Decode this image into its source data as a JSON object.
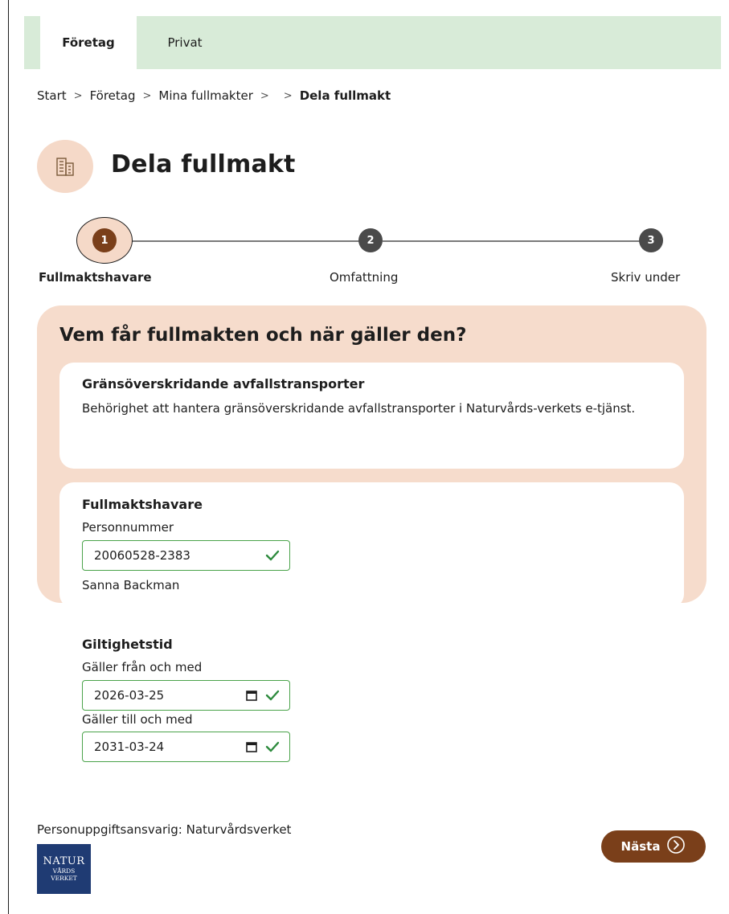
{
  "tabs": [
    {
      "label": "Företag",
      "active": true
    },
    {
      "label": "Privat",
      "active": false
    }
  ],
  "breadcrumb": [
    "Start",
    "Företag",
    "Mina fullmakter",
    "",
    "Dela fullmakt"
  ],
  "page": {
    "title": "Dela fullmakt",
    "icon": "building-icon"
  },
  "stepper": {
    "steps": [
      {
        "number": "1",
        "label": "Fullmaktshavare",
        "state": "active"
      },
      {
        "number": "2",
        "label": "Omfattning",
        "state": "inactive"
      },
      {
        "number": "3",
        "label": "Skriv under",
        "state": "inactive"
      }
    ]
  },
  "form": {
    "heading": "Vem får fullmakten och när gäller den?",
    "permission": {
      "title": "Gränsöverskridande avfallstransporter",
      "description": "Behörighet att hantera gränsöverskridande avfallstransporter i Naturvårds-verkets e-tjänst."
    },
    "holder": {
      "title": "Fullmaktshavare",
      "id_label": "Personnummer",
      "id_value": "20060528-2383",
      "name": "Sanna Backman"
    },
    "validity": {
      "title": "Giltighetstid",
      "from_label": "Gäller från och med",
      "from_value": "2026-03-25",
      "to_label": "Gäller till och med",
      "to_value": "2031-03-24"
    }
  },
  "footer": {
    "controller_text": "Personuppgiftsansvarig: Naturvårdsverket",
    "logo_line1": "NATUR",
    "logo_line2": "VÅRDS",
    "logo_line3": "VERKET",
    "next_label": "Nästa"
  },
  "colors": {
    "tabbar": "#d8ebd8",
    "panel": "#f6dccc",
    "accent_brown": "#7a3f1a",
    "step_inactive": "#4a4a4a",
    "valid_green": "#4aa34a",
    "logo_blue": "#1f3b73"
  }
}
